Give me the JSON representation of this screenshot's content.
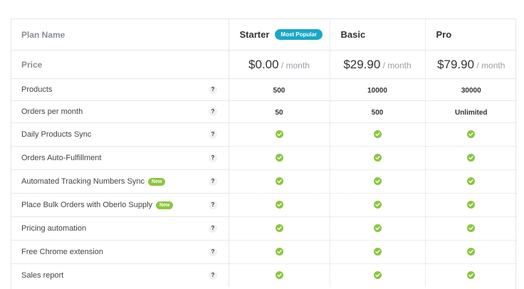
{
  "header": {
    "plan_name_label": "Plan Name",
    "price_label": "Price",
    "plans": [
      {
        "name": "Starter",
        "badge": "Most Popular",
        "price": "$0.00",
        "per": " / month"
      },
      {
        "name": "Basic",
        "badge": "",
        "price": "$29.90",
        "per": " / month"
      },
      {
        "name": "Pro",
        "badge": "",
        "price": "$79.90",
        "per": " / month"
      }
    ]
  },
  "help_glyph": "?",
  "new_badge": "New",
  "features": [
    {
      "label": "Products",
      "values": [
        "500",
        "10000",
        "30000"
      ]
    },
    {
      "label": "Orders per month",
      "values": [
        "50",
        "500",
        "Unlimited"
      ]
    },
    {
      "label": "Daily Products Sync",
      "values": [
        "check",
        "check",
        "check"
      ]
    },
    {
      "label": "Orders Auto-Fulfillment",
      "values": [
        "check",
        "check",
        "check"
      ]
    },
    {
      "label": "Automated Tracking Numbers Sync",
      "badge": "New",
      "values": [
        "check",
        "check",
        "check"
      ]
    },
    {
      "label": "Place Bulk Orders with Oberlo Supply",
      "badge": "New",
      "values": [
        "check",
        "check",
        "check"
      ]
    },
    {
      "label": "Pricing automation",
      "values": [
        "check",
        "check",
        "check"
      ]
    },
    {
      "label": "Free Chrome extension",
      "values": [
        "check",
        "check",
        "check"
      ]
    },
    {
      "label": "Sales report",
      "values": [
        "check",
        "check",
        "check"
      ]
    }
  ],
  "colors": {
    "accent": "#1aa7c7",
    "check": "#8cc63f",
    "new_badge": "#8cc63f"
  }
}
